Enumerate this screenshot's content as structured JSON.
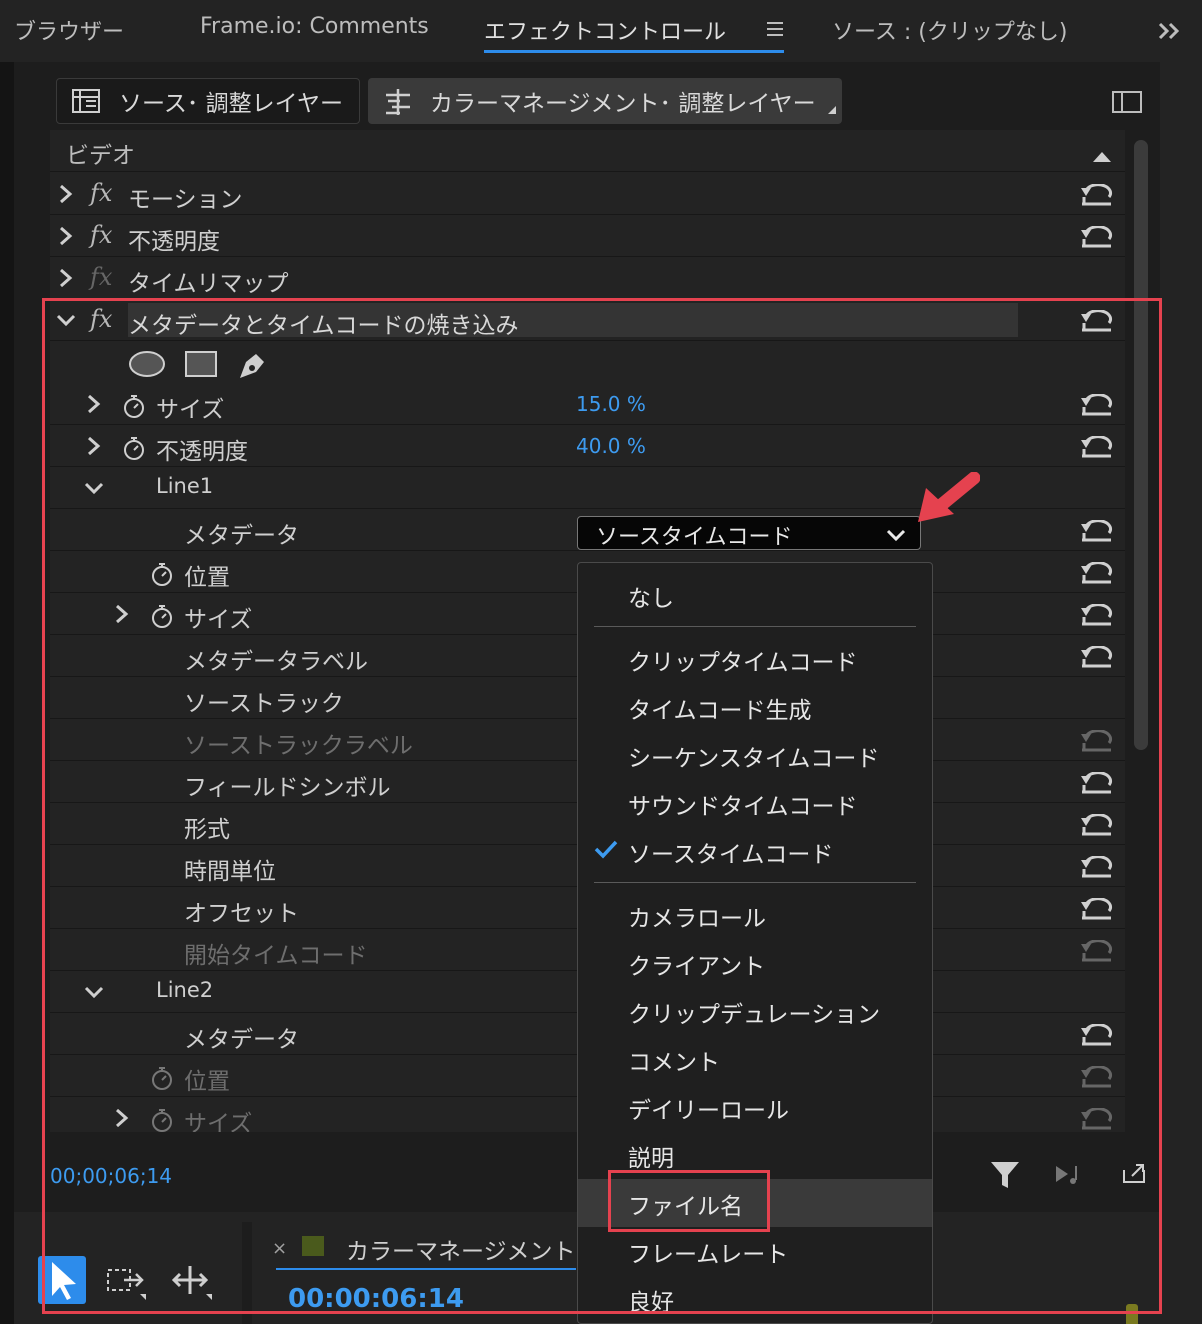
{
  "tabs": [
    {
      "label": "ブラウザー"
    },
    {
      "label": "Frame.io: Comments"
    },
    {
      "label": "エフェクトコントロール"
    },
    {
      "label": "ソース : (クリップなし)"
    }
  ],
  "clip_header": {
    "source_label": "ソース･ 調整レイヤー",
    "target_label": "カラーマネージメント･ 調整レイヤー"
  },
  "section": {
    "video_label": "ビデオ"
  },
  "effects": {
    "motion": "モーション",
    "opacity": "不透明度",
    "time_remap": "タイムリマップ",
    "burnin": "メタデータとタイムコードの焼き込み"
  },
  "props": {
    "size_label": "サイズ",
    "size_value": "15.0 %",
    "opacity_label": "不透明度",
    "opacity_value": "40.0 %",
    "line1": "Line1",
    "metadata_label": "メタデータ",
    "metadata_value": "ソースタイムコード",
    "position": "位置",
    "size": "サイズ",
    "metadata_text_label": "メタデータラベル",
    "source_track": "ソーストラック",
    "source_track_label": "ソーストラックラベル",
    "field_symbol": "フィールドシンボル",
    "format": "形式",
    "time_unit": "時間単位",
    "offset": "オフセット",
    "start_timecode": "開始タイムコード",
    "line2": "Line2",
    "metadata2": "メタデータ",
    "position2": "位置",
    "size2": "サイズ"
  },
  "menu": {
    "items": [
      "なし",
      "クリップタイムコード",
      "タイムコード生成",
      "シーケンスタイムコード",
      "サウンドタイムコード",
      "ソースタイムコード",
      "カメラロール",
      "クライアント",
      "クリップデュレーション",
      "コメント",
      "デイリーロール",
      "説明",
      "ファイル名",
      "フレームレート",
      "良好"
    ],
    "selected": "ソースタイムコード",
    "hovered": "ファイル名"
  },
  "footer": {
    "timecode": "00;00;06;14"
  },
  "sequence": {
    "close": "×",
    "name": "カラーマネージメント",
    "timecode": "00:00:06:14"
  },
  "colors": {
    "accent": "#2d8ceb",
    "value_blue": "#3d9bf0",
    "highlight_red": "#e5424f"
  }
}
